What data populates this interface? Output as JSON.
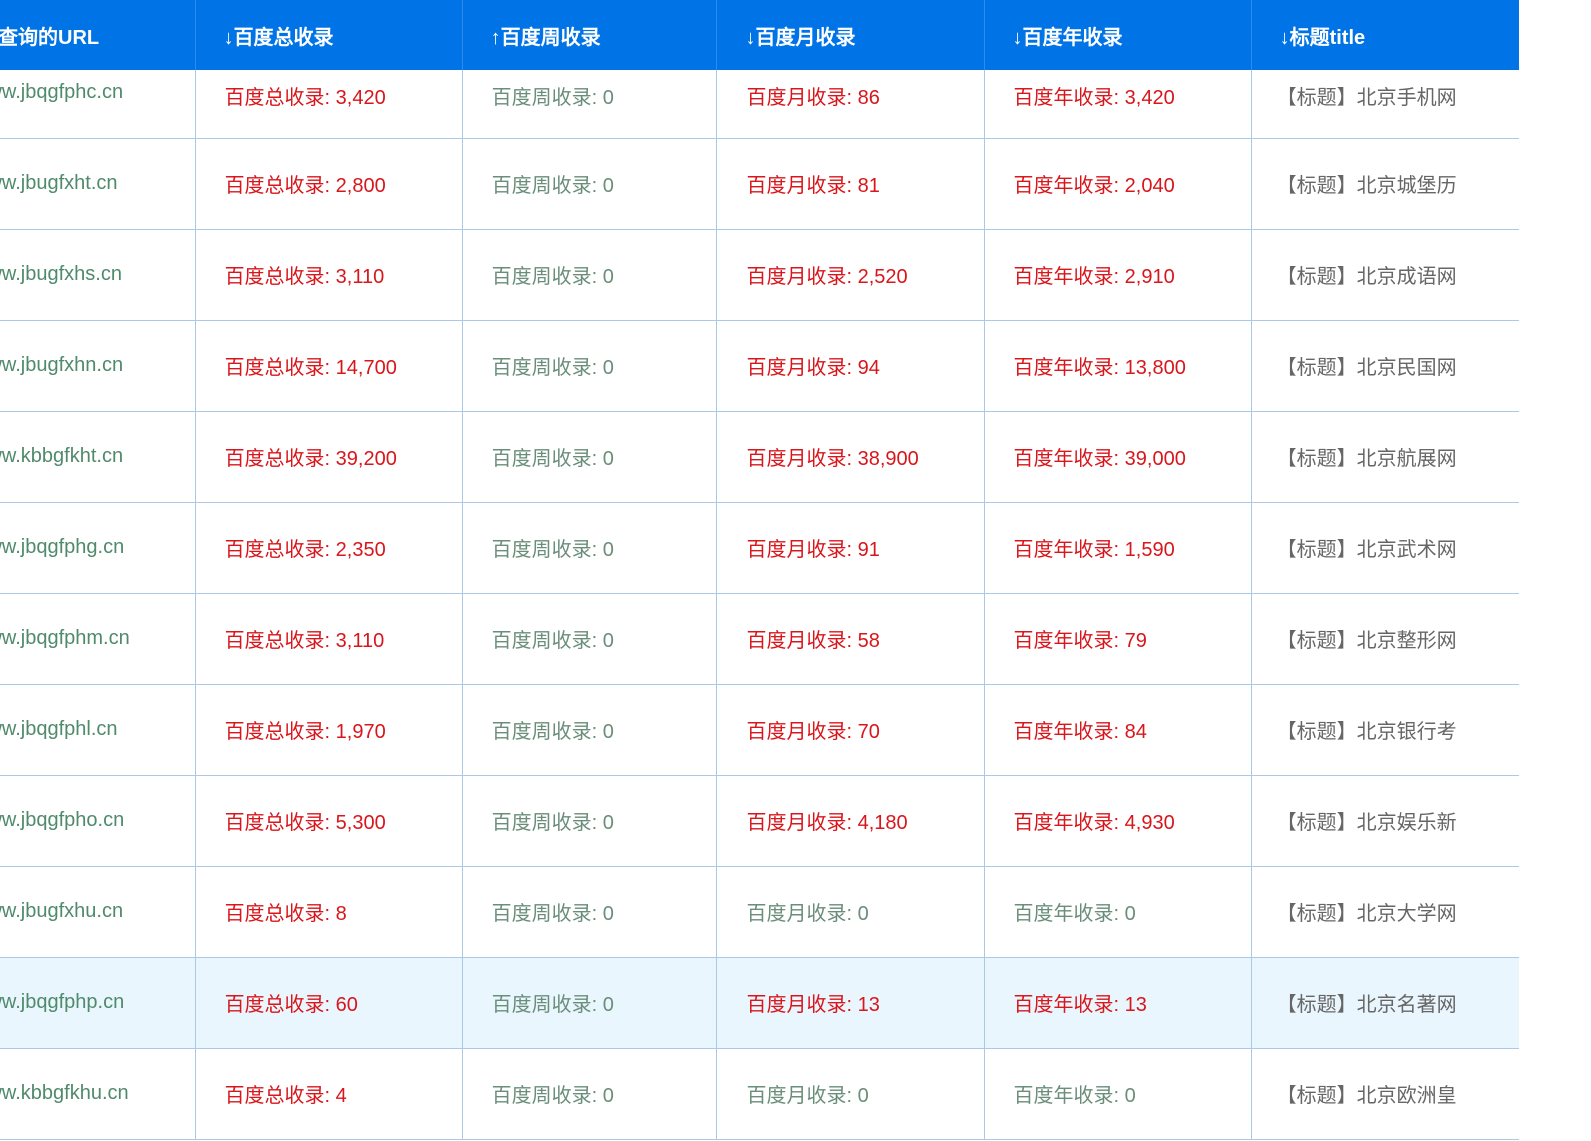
{
  "colors": {
    "header_bg": "#0073e6",
    "header_text": "#ffffff",
    "highlight": "#d8161b",
    "muted": "#6a8e79",
    "url": "#4f8a6b",
    "title_text": "#666666",
    "row_highlight_bg": "#eaf6fe"
  },
  "table": {
    "headers": {
      "url": "查询的URL",
      "total": "↓百度总收录",
      "week": "↑百度周收录",
      "month": "↓百度月收录",
      "year": "↓百度年收录",
      "title": "↓标题title"
    },
    "rows": [
      {
        "url": "www.jbqgfphc.cn",
        "total": "百度总收录: 3,420",
        "week": "百度周收录: 0",
        "month": "百度月收录: 86",
        "year": "百度年收录: 3,420",
        "title": "【标题】北京手机网"
      },
      {
        "url": "www.jbugfxht.cn",
        "total": "百度总收录: 2,800",
        "week": "百度周收录: 0",
        "month": "百度月收录: 81",
        "year": "百度年收录: 2,040",
        "title": "【标题】北京城堡历"
      },
      {
        "url": "www.jbugfxhs.cn",
        "total": "百度总收录: 3,110",
        "week": "百度周收录: 0",
        "month": "百度月收录: 2,520",
        "year": "百度年收录: 2,910",
        "title": "【标题】北京成语网"
      },
      {
        "url": "www.jbugfxhn.cn",
        "total": "百度总收录: 14,700",
        "week": "百度周收录: 0",
        "month": "百度月收录: 94",
        "year": "百度年收录: 13,800",
        "title": "【标题】北京民国网"
      },
      {
        "url": "www.kbbgfkht.cn",
        "total": "百度总收录: 39,200",
        "week": "百度周收录: 0",
        "month": "百度月收录: 38,900",
        "year": "百度年收录: 39,000",
        "title": "【标题】北京航展网"
      },
      {
        "url": "www.jbqgfphg.cn",
        "total": "百度总收录: 2,350",
        "week": "百度周收录: 0",
        "month": "百度月收录: 91",
        "year": "百度年收录: 1,590",
        "title": "【标题】北京武术网"
      },
      {
        "url": "www.jbqgfphm.cn",
        "total": "百度总收录: 3,110",
        "week": "百度周收录: 0",
        "month": "百度月收录: 58",
        "year": "百度年收录: 79",
        "title": "【标题】北京整形网"
      },
      {
        "url": "www.jbqgfphl.cn",
        "total": "百度总收录: 1,970",
        "week": "百度周收录: 0",
        "month": "百度月收录: 70",
        "year": "百度年收录: 84",
        "title": "【标题】北京银行考"
      },
      {
        "url": "www.jbqgfpho.cn",
        "total": "百度总收录: 5,300",
        "week": "百度周收录: 0",
        "month": "百度月收录: 4,180",
        "year": "百度年收录: 4,930",
        "title": "【标题】北京娱乐新"
      },
      {
        "url": "www.jbugfxhu.cn",
        "total": "百度总收录: 8",
        "week": "百度周收录: 0",
        "month": "百度月收录: 0",
        "year": "百度年收录: 0",
        "title": "【标题】北京大学网"
      },
      {
        "url": "www.jbqgfphp.cn",
        "total": "百度总收录: 60",
        "week": "百度周收录: 0",
        "month": "百度月收录: 13",
        "year": "百度年收录: 13",
        "title": "【标题】北京名著网"
      },
      {
        "url": "www.kbbgfkhu.cn",
        "total": "百度总收录: 4",
        "week": "百度周收录: 0",
        "month": "百度月收录: 0",
        "year": "百度年收录: 0",
        "title": "【标题】北京欧洲皇"
      }
    ]
  }
}
